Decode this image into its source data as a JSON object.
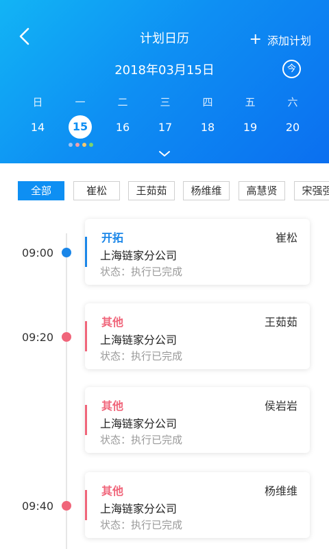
{
  "header": {
    "title": "计划日历",
    "add_label": "添加计划",
    "add_icon": "plus-icon",
    "back_icon": "chevron-left-icon",
    "date": "2018年03月15日",
    "today_label": "今",
    "expand_icon": "chevron-down-icon"
  },
  "week": {
    "weekdays": [
      "日",
      "一",
      "二",
      "三",
      "四",
      "五",
      "六"
    ],
    "days": [
      "14",
      "15",
      "16",
      "17",
      "18",
      "19",
      "20"
    ],
    "selected_index": 1,
    "dot_colors": [
      "#9ec3f2",
      "#f5a0a8",
      "#f5c86e",
      "#7fd36b"
    ]
  },
  "filters": [
    "全部",
    "崔松",
    "王茹茹",
    "杨维维",
    "高慧贤",
    "宋强强"
  ],
  "timeline": {
    "times": [
      "09:00",
      "09:20",
      "09:40"
    ],
    "colors": {
      "kaituo": "#1a86e8",
      "other": "#f0657a"
    },
    "cards": [
      {
        "type": "开拓",
        "person": "崔松",
        "company": "上海链家分公司",
        "status": "状态：执行已完成"
      },
      {
        "type": "其他",
        "person": "王茹茹",
        "company": "上海链家分公司",
        "status": "状态：执行已完成"
      },
      {
        "type": "其他",
        "person": "侯岩岩",
        "company": "上海链家分公司",
        "status": "状态：执行已完成"
      },
      {
        "type": "其他",
        "person": "杨维维",
        "company": "上海链家分公司",
        "status": "状态：执行已完成"
      }
    ]
  }
}
